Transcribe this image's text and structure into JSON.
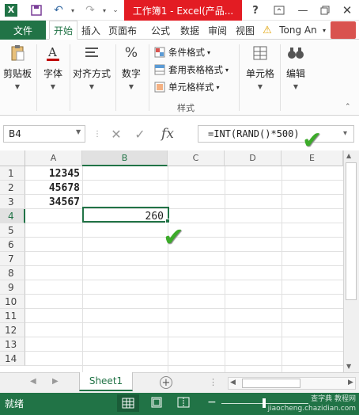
{
  "title_bar": {
    "title": "工作簿1 - Excel(产品...",
    "help": "?",
    "minimize": "—"
  },
  "ribbon_tabs": {
    "file": "文件",
    "home": "开始",
    "insert": "插入",
    "page_layout": "页面布",
    "formulas": "公式",
    "data": "数据",
    "review": "审阅",
    "view": "视图",
    "user": "Tong An"
  },
  "ribbon": {
    "clipboard": "剪贴板",
    "font": "字体",
    "alignment": "对齐方式",
    "number": "数字",
    "conditional_format": "条件格式",
    "table_format": "套用表格格式",
    "cell_style": "单元格样式",
    "styles_group": "样式",
    "cells": "单元格",
    "editing": "编辑"
  },
  "formula_bar": {
    "name_box": "B4",
    "fx": "fx",
    "formula": "=INT(RAND()*500)"
  },
  "columns": [
    "A",
    "B",
    "C",
    "D",
    "E"
  ],
  "rows": [
    "1",
    "2",
    "3",
    "4",
    "5",
    "6",
    "7",
    "8",
    "9",
    "10",
    "11",
    "12",
    "13",
    "14"
  ],
  "cells": {
    "A1": "12345",
    "A2": "45678",
    "A3": "34567",
    "B4": "260"
  },
  "sheet_tabs": {
    "sheet1": "Sheet1",
    "add": "+"
  },
  "status_bar": {
    "status": "就绪"
  },
  "watermark": "查字典 教程网 jiaocheng.chazidian.com",
  "colors": {
    "excel_green": "#217346",
    "title_red": "#e31c23",
    "check_green": "#3cab2a"
  }
}
